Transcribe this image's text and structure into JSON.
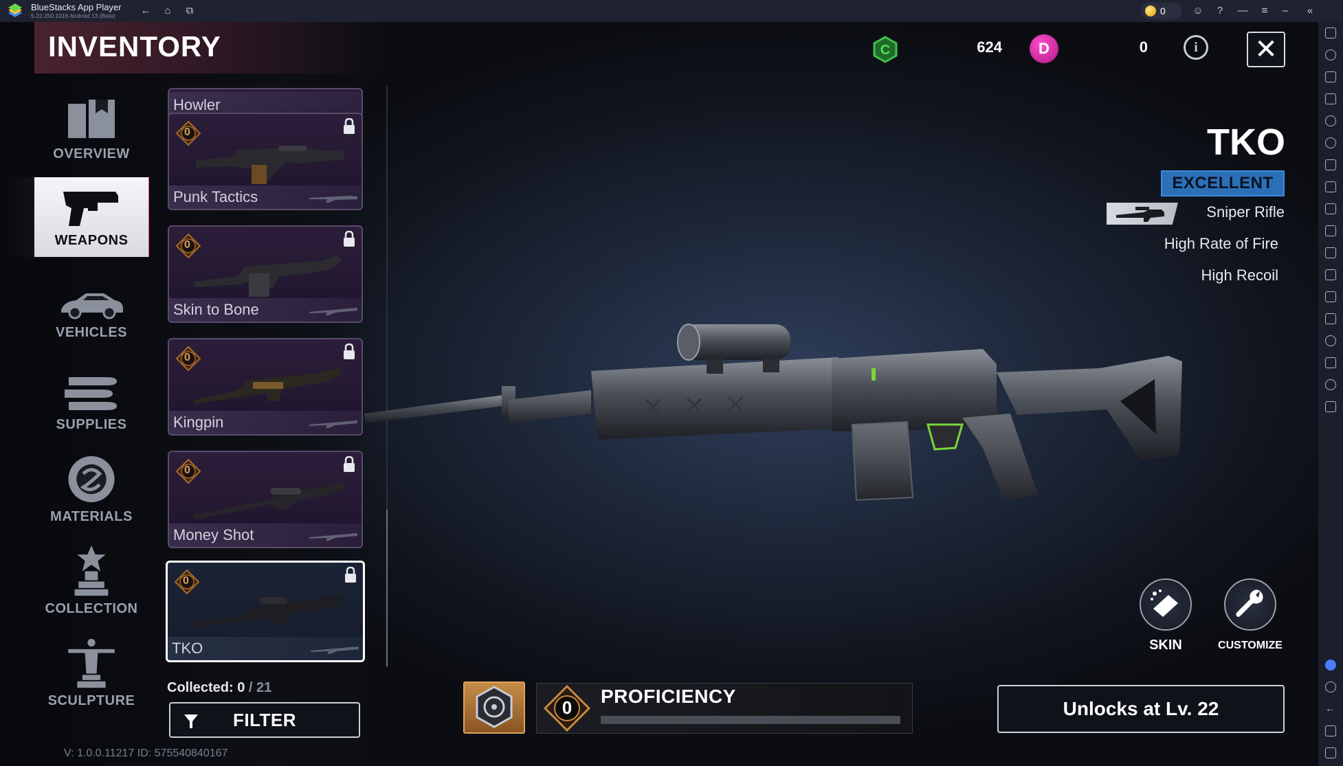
{
  "window": {
    "app_title": "BlueStacks App Player",
    "version": "5.22.250.1016  Android 13 (Beta)",
    "coins": "0"
  },
  "header": {
    "title": "INVENTORY",
    "currency_c_value": "624",
    "currency_d_value": "0",
    "currency_d_letter": "D"
  },
  "nav": {
    "items": [
      {
        "label": "OVERVIEW",
        "icon": "overview-icon"
      },
      {
        "label": "WEAPONS",
        "icon": "pistol-icon",
        "active": true
      },
      {
        "label": "VEHICLES",
        "icon": "car-icon"
      },
      {
        "label": "SUPPLIES",
        "icon": "ammo-icon"
      },
      {
        "label": "MATERIALS",
        "icon": "materials-icon"
      },
      {
        "label": "COLLECTION",
        "icon": "trophy-icon"
      },
      {
        "label": "SCULPTURE",
        "icon": "statue-icon"
      }
    ]
  },
  "weapons": {
    "cards": [
      {
        "name": "Howler",
        "level": "0",
        "locked": true
      },
      {
        "name": "Punk Tactics",
        "level": "0",
        "locked": true
      },
      {
        "name": "Skin to Bone",
        "level": "0",
        "locked": true
      },
      {
        "name": "Kingpin",
        "level": "0",
        "locked": true
      },
      {
        "name": "Money Shot",
        "level": "0",
        "locked": true
      },
      {
        "name": "TKO",
        "level": "0",
        "locked": true,
        "selected": true
      }
    ],
    "collected_label": "Collected: ",
    "collected_count": "0",
    "collected_total": "21",
    "filter_label": "FILTER"
  },
  "footer": {
    "version": "V: 1.0.0.11217   ID: 575540840167"
  },
  "detail": {
    "name": "TKO",
    "rarity": "EXCELLENT",
    "type": "Sniper Rifle",
    "traits": [
      "High Rate of Fire",
      "High Recoil"
    ],
    "skin_label": "SKIN",
    "customize_label": "CUSTOMIZE",
    "proficiency_label": "PROFICIENCY",
    "proficiency_level": "0",
    "proficiency_progress": 0,
    "unlock_label": "Unlocks at Lv. 22"
  },
  "colors": {
    "rarity": "#2b6fb7",
    "active_stripe": "#e14b86",
    "currency_c": "#3cc24a",
    "currency_d": "#d61d9c"
  }
}
